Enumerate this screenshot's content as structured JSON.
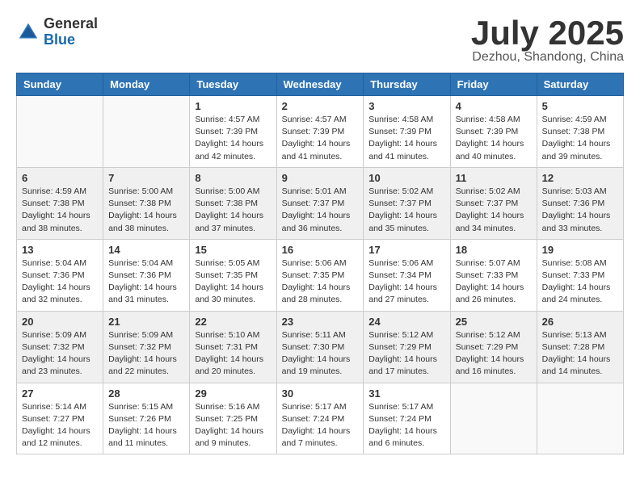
{
  "logo": {
    "general": "General",
    "blue": "Blue"
  },
  "header": {
    "month": "July 2025",
    "location": "Dezhou, Shandong, China"
  },
  "weekdays": [
    "Sunday",
    "Monday",
    "Tuesday",
    "Wednesday",
    "Thursday",
    "Friday",
    "Saturday"
  ],
  "weeks": [
    [
      {
        "day": "",
        "sunrise": "",
        "sunset": "",
        "daylight": ""
      },
      {
        "day": "",
        "sunrise": "",
        "sunset": "",
        "daylight": ""
      },
      {
        "day": "1",
        "sunrise": "Sunrise: 4:57 AM",
        "sunset": "Sunset: 7:39 PM",
        "daylight": "Daylight: 14 hours and 42 minutes."
      },
      {
        "day": "2",
        "sunrise": "Sunrise: 4:57 AM",
        "sunset": "Sunset: 7:39 PM",
        "daylight": "Daylight: 14 hours and 41 minutes."
      },
      {
        "day": "3",
        "sunrise": "Sunrise: 4:58 AM",
        "sunset": "Sunset: 7:39 PM",
        "daylight": "Daylight: 14 hours and 41 minutes."
      },
      {
        "day": "4",
        "sunrise": "Sunrise: 4:58 AM",
        "sunset": "Sunset: 7:39 PM",
        "daylight": "Daylight: 14 hours and 40 minutes."
      },
      {
        "day": "5",
        "sunrise": "Sunrise: 4:59 AM",
        "sunset": "Sunset: 7:38 PM",
        "daylight": "Daylight: 14 hours and 39 minutes."
      }
    ],
    [
      {
        "day": "6",
        "sunrise": "Sunrise: 4:59 AM",
        "sunset": "Sunset: 7:38 PM",
        "daylight": "Daylight: 14 hours and 38 minutes."
      },
      {
        "day": "7",
        "sunrise": "Sunrise: 5:00 AM",
        "sunset": "Sunset: 7:38 PM",
        "daylight": "Daylight: 14 hours and 38 minutes."
      },
      {
        "day": "8",
        "sunrise": "Sunrise: 5:00 AM",
        "sunset": "Sunset: 7:38 PM",
        "daylight": "Daylight: 14 hours and 37 minutes."
      },
      {
        "day": "9",
        "sunrise": "Sunrise: 5:01 AM",
        "sunset": "Sunset: 7:37 PM",
        "daylight": "Daylight: 14 hours and 36 minutes."
      },
      {
        "day": "10",
        "sunrise": "Sunrise: 5:02 AM",
        "sunset": "Sunset: 7:37 PM",
        "daylight": "Daylight: 14 hours and 35 minutes."
      },
      {
        "day": "11",
        "sunrise": "Sunrise: 5:02 AM",
        "sunset": "Sunset: 7:37 PM",
        "daylight": "Daylight: 14 hours and 34 minutes."
      },
      {
        "day": "12",
        "sunrise": "Sunrise: 5:03 AM",
        "sunset": "Sunset: 7:36 PM",
        "daylight": "Daylight: 14 hours and 33 minutes."
      }
    ],
    [
      {
        "day": "13",
        "sunrise": "Sunrise: 5:04 AM",
        "sunset": "Sunset: 7:36 PM",
        "daylight": "Daylight: 14 hours and 32 minutes."
      },
      {
        "day": "14",
        "sunrise": "Sunrise: 5:04 AM",
        "sunset": "Sunset: 7:36 PM",
        "daylight": "Daylight: 14 hours and 31 minutes."
      },
      {
        "day": "15",
        "sunrise": "Sunrise: 5:05 AM",
        "sunset": "Sunset: 7:35 PM",
        "daylight": "Daylight: 14 hours and 30 minutes."
      },
      {
        "day": "16",
        "sunrise": "Sunrise: 5:06 AM",
        "sunset": "Sunset: 7:35 PM",
        "daylight": "Daylight: 14 hours and 28 minutes."
      },
      {
        "day": "17",
        "sunrise": "Sunrise: 5:06 AM",
        "sunset": "Sunset: 7:34 PM",
        "daylight": "Daylight: 14 hours and 27 minutes."
      },
      {
        "day": "18",
        "sunrise": "Sunrise: 5:07 AM",
        "sunset": "Sunset: 7:33 PM",
        "daylight": "Daylight: 14 hours and 26 minutes."
      },
      {
        "day": "19",
        "sunrise": "Sunrise: 5:08 AM",
        "sunset": "Sunset: 7:33 PM",
        "daylight": "Daylight: 14 hours and 24 minutes."
      }
    ],
    [
      {
        "day": "20",
        "sunrise": "Sunrise: 5:09 AM",
        "sunset": "Sunset: 7:32 PM",
        "daylight": "Daylight: 14 hours and 23 minutes."
      },
      {
        "day": "21",
        "sunrise": "Sunrise: 5:09 AM",
        "sunset": "Sunset: 7:32 PM",
        "daylight": "Daylight: 14 hours and 22 minutes."
      },
      {
        "day": "22",
        "sunrise": "Sunrise: 5:10 AM",
        "sunset": "Sunset: 7:31 PM",
        "daylight": "Daylight: 14 hours and 20 minutes."
      },
      {
        "day": "23",
        "sunrise": "Sunrise: 5:11 AM",
        "sunset": "Sunset: 7:30 PM",
        "daylight": "Daylight: 14 hours and 19 minutes."
      },
      {
        "day": "24",
        "sunrise": "Sunrise: 5:12 AM",
        "sunset": "Sunset: 7:29 PM",
        "daylight": "Daylight: 14 hours and 17 minutes."
      },
      {
        "day": "25",
        "sunrise": "Sunrise: 5:12 AM",
        "sunset": "Sunset: 7:29 PM",
        "daylight": "Daylight: 14 hours and 16 minutes."
      },
      {
        "day": "26",
        "sunrise": "Sunrise: 5:13 AM",
        "sunset": "Sunset: 7:28 PM",
        "daylight": "Daylight: 14 hours and 14 minutes."
      }
    ],
    [
      {
        "day": "27",
        "sunrise": "Sunrise: 5:14 AM",
        "sunset": "Sunset: 7:27 PM",
        "daylight": "Daylight: 14 hours and 12 minutes."
      },
      {
        "day": "28",
        "sunrise": "Sunrise: 5:15 AM",
        "sunset": "Sunset: 7:26 PM",
        "daylight": "Daylight: 14 hours and 11 minutes."
      },
      {
        "day": "29",
        "sunrise": "Sunrise: 5:16 AM",
        "sunset": "Sunset: 7:25 PM",
        "daylight": "Daylight: 14 hours and 9 minutes."
      },
      {
        "day": "30",
        "sunrise": "Sunrise: 5:17 AM",
        "sunset": "Sunset: 7:24 PM",
        "daylight": "Daylight: 14 hours and 7 minutes."
      },
      {
        "day": "31",
        "sunrise": "Sunrise: 5:17 AM",
        "sunset": "Sunset: 7:24 PM",
        "daylight": "Daylight: 14 hours and 6 minutes."
      },
      {
        "day": "",
        "sunrise": "",
        "sunset": "",
        "daylight": ""
      },
      {
        "day": "",
        "sunrise": "",
        "sunset": "",
        "daylight": ""
      }
    ]
  ]
}
